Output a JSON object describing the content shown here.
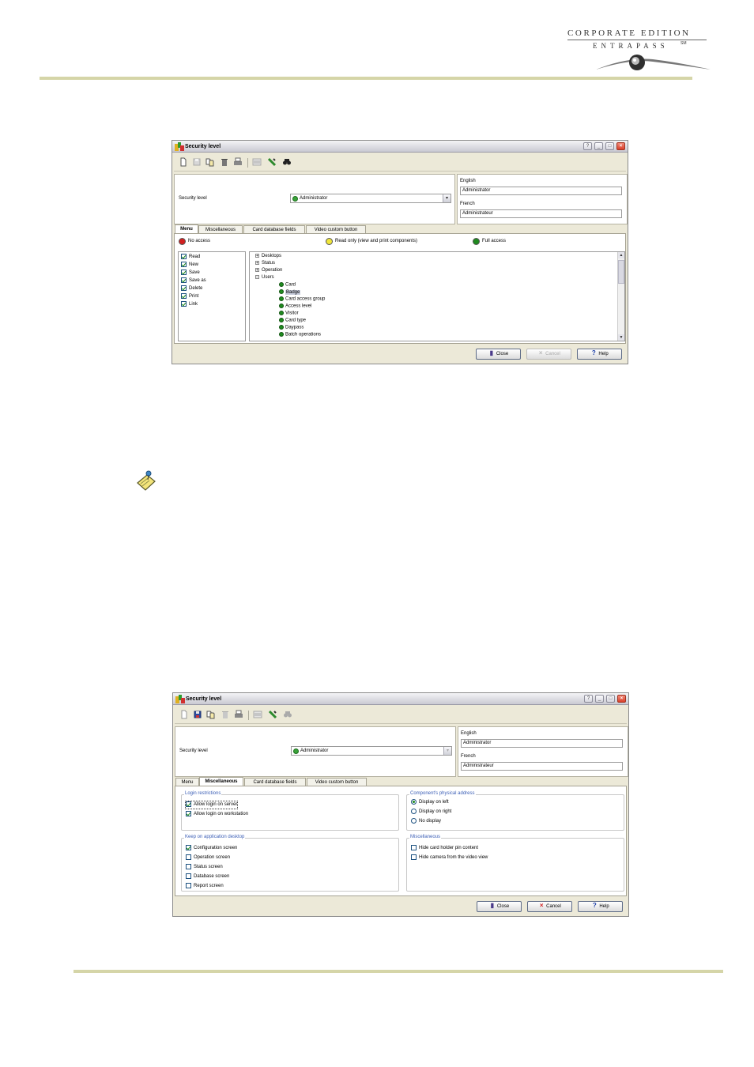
{
  "header": {
    "logo_line1": "CORPORATE EDITION",
    "logo_line2": "ENTRAPASS",
    "logo_tm": "SM"
  },
  "colors": {
    "rule": "#d5d5a8",
    "no_access": "#d22020",
    "read_only": "#f0e63a",
    "full_access": "#1f8a1f"
  },
  "dialog1": {
    "title": "Security level",
    "security_level_label": "Security level",
    "security_level_value": "Administrator",
    "english_label": "English",
    "english_value": "Administrator",
    "french_label": "French",
    "french_value": "Administrateur",
    "tabs": [
      "Menu",
      "Miscellaneous",
      "Card database fields",
      "Video custom button"
    ],
    "active_tab": "Menu",
    "legend": {
      "no_access": "No access",
      "read_only": "Read only (view and print components)",
      "full_access": "Full access"
    },
    "permissions": [
      {
        "label": "Read",
        "checked": true
      },
      {
        "label": "New",
        "checked": true
      },
      {
        "label": "Save",
        "checked": true
      },
      {
        "label": "Save as",
        "checked": true
      },
      {
        "label": "Delete",
        "checked": true
      },
      {
        "label": "Print",
        "checked": true
      },
      {
        "label": "Link",
        "checked": true
      }
    ],
    "tree": {
      "top": [
        "Desktops",
        "Status",
        "Operation",
        "Users"
      ],
      "users_children": [
        "Card",
        "Badge",
        "Card access group",
        "Access level",
        "Visitor",
        "Card type",
        "Daypass",
        "Batch operations"
      ],
      "selected": "Badge"
    },
    "buttons": {
      "close": "Close",
      "cancel": "Cancel",
      "help": "Help"
    }
  },
  "dialog2": {
    "title": "Security level",
    "security_level_label": "Security level",
    "security_level_value": "Administrator",
    "english_label": "English",
    "english_value": "Administrator",
    "french_label": "French",
    "french_value": "Administrateur",
    "tabs": [
      "Menu",
      "Miscellaneous",
      "Card database fields",
      "Video custom button"
    ],
    "active_tab": "Miscellaneous",
    "login_restrictions": {
      "title": "Login restrictions",
      "items": [
        {
          "label": "Allow login on server",
          "checked": true
        },
        {
          "label": "Allow login on workstation",
          "checked": true
        }
      ]
    },
    "physical_address": {
      "title": "Component's physical address",
      "items": [
        {
          "label": "Display on left",
          "selected": true
        },
        {
          "label": "Display on right",
          "selected": false
        },
        {
          "label": "No display",
          "selected": false
        }
      ]
    },
    "keep_on_desktop": {
      "title": "Keep on application desktop",
      "items": [
        {
          "label": "Configuration screen",
          "checked": true
        },
        {
          "label": "Operation screen",
          "checked": false
        },
        {
          "label": "Status screen",
          "checked": false
        },
        {
          "label": "Database screen",
          "checked": false
        },
        {
          "label": "Report screen",
          "checked": false
        }
      ]
    },
    "miscellaneous": {
      "title": "Miscellaneous",
      "items": [
        {
          "label": "Hide card holder pin content",
          "checked": false
        },
        {
          "label": "Hide camera from the video view",
          "checked": false
        }
      ]
    },
    "buttons": {
      "close": "Close",
      "cancel": "Cancel",
      "help": "Help"
    }
  }
}
